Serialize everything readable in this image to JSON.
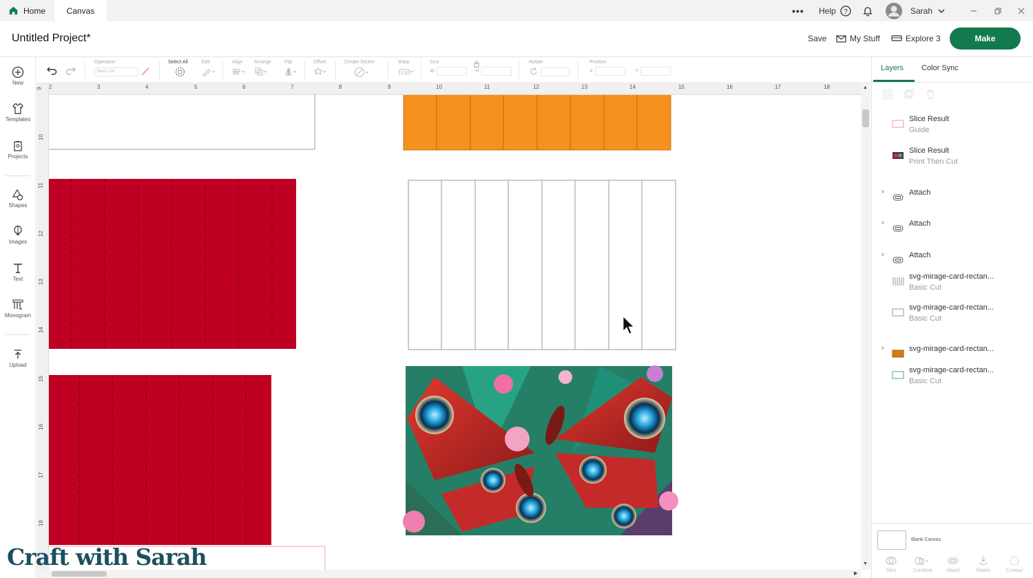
{
  "tabs": {
    "home": "Home",
    "canvas": "Canvas"
  },
  "topbar": {
    "help": "Help",
    "user": "Sarah",
    "more": "•••"
  },
  "header": {
    "title": "Untitled Project*",
    "save": "Save",
    "my_stuff": "My Stuff",
    "machine": "Explore 3",
    "make": "Make"
  },
  "leftbar": {
    "new": "New",
    "templates": "Templates",
    "projects": "Projects",
    "shapes": "Shapes",
    "images": "Images",
    "text": "Text",
    "monogram": "Monogram",
    "upload": "Upload"
  },
  "toolbar": {
    "operation": "Operation",
    "operation_value": "Basic Cut",
    "select_all": "Select All",
    "edit": "Edit",
    "align": "Align",
    "arrange": "Arrange",
    "flip": "Flip",
    "offset": "Offset",
    "create_sticker": "Create Sticker",
    "warp": "Warp",
    "size": "Size",
    "w": "W",
    "h": "H",
    "rotate": "Rotate",
    "position": "Position",
    "x": "X",
    "y": "Y"
  },
  "ruler": {
    "top": [
      "2",
      "3",
      "4",
      "5",
      "6",
      "7",
      "8",
      "9",
      "10",
      "11",
      "12",
      "13",
      "14",
      "15",
      "16",
      "17",
      "18"
    ],
    "left": [
      "9",
      "10",
      "11",
      "12",
      "13",
      "14",
      "15",
      "16",
      "17",
      "18"
    ]
  },
  "panel": {
    "tabs": {
      "layers": "Layers",
      "color_sync": "Color Sync"
    },
    "layers": [
      {
        "name": "Slice Result",
        "sub": "Guide"
      },
      {
        "name": "Slice Result",
        "sub": "Print Then Cut"
      },
      {
        "name": "Attach",
        "sub": ""
      },
      {
        "name": "Attach",
        "sub": ""
      },
      {
        "name": "Attach",
        "sub": ""
      },
      {
        "name": "svg-mirage-card-rectan...",
        "sub": "Basic Cut"
      },
      {
        "name": "svg-mirage-card-rectan...",
        "sub": "Basic Cut"
      },
      {
        "name": "svg-mirage-card-rectan...",
        "sub": ""
      },
      {
        "name": "svg-mirage-card-rectan...",
        "sub": "Basic Cut"
      }
    ],
    "blank_canvas": "Blank Canvas",
    "footer": {
      "slice": "Slice",
      "combine": "Combine",
      "attach": "Attach",
      "flatten": "Flatten",
      "contour": "Contour"
    }
  },
  "colors": {
    "accent": "#127a4e",
    "orange": "#f5921e",
    "red": "#c00023"
  },
  "watermark": "Craft with Sarah"
}
